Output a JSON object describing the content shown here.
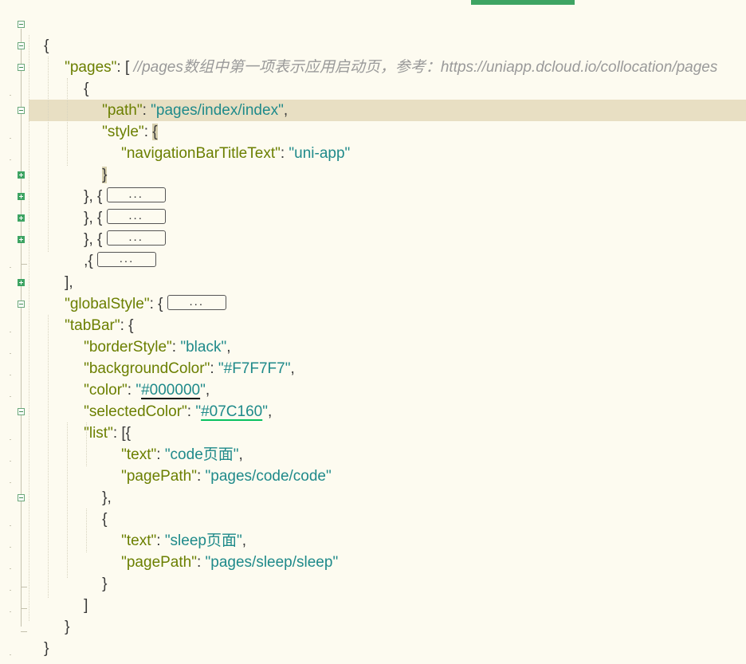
{
  "editor": {
    "colors": {
      "background": "#FDFBF0",
      "current_line": "#E8DFC3",
      "key": "#6B7F00",
      "string": "#1F8A8A",
      "comment": "#9A9A9A",
      "fold_collapsed": "#3EA463",
      "active_tab": "#3EA463"
    },
    "icons": {
      "fold_expanded": "minus-box-icon",
      "fold_collapsed": "plus-box-icon"
    },
    "placeholder": "...",
    "lines": {
      "l1": {
        "p1": "{"
      },
      "l2": {
        "k1": "\"pages\"",
        "p1": ": [ ",
        "comment": "//pages数组中第一项表示应用启动页，参考：https://uniapp.dcloud.io/collocation/pages"
      },
      "l3": {
        "p1": "{"
      },
      "l4": {
        "k1": "\"path\"",
        "p1": ": ",
        "s1": "\"pages/index/index\"",
        "p2": ","
      },
      "l5": {
        "k1": "\"style\"",
        "p1": ": ",
        "p2": "{"
      },
      "l6": {
        "k1": "\"navigationBarTitleText\"",
        "p1": ": ",
        "s1": "\"uni-app\""
      },
      "l7": {
        "p1": "}"
      },
      "l8": {
        "p1": "}, { "
      },
      "l9": {
        "p1": "}, { "
      },
      "l10": {
        "p1": "}, { "
      },
      "l11": {
        "p1": ",{ "
      },
      "l12": {
        "p1": "],"
      },
      "l13": {
        "k1": "\"globalStyle\"",
        "p1": ": { "
      },
      "l14": {
        "k1": "\"tabBar\"",
        "p1": ": {"
      },
      "l15": {
        "k1": "\"borderStyle\"",
        "p1": ": ",
        "s1": "\"black\"",
        "p2": ","
      },
      "l16": {
        "k1": "\"backgroundColor\"",
        "p1": ": ",
        "s1": "\"#F7F7F7\"",
        "p2": ","
      },
      "l17": {
        "k1": "\"color\"",
        "p1": ": ",
        "q1": "\"",
        "s1": "#000000",
        "q2": "\"",
        "p2": ",",
        "swatch": "#000000"
      },
      "l18": {
        "k1": "\"selectedColor\"",
        "p1": ": ",
        "q1": "\"",
        "s1": "#07C160",
        "q2": "\"",
        "p2": ",",
        "swatch": "#07C160"
      },
      "l19": {
        "k1": "\"list\"",
        "p1": ": [{"
      },
      "l20": {
        "k1": "\"text\"",
        "p1": ": ",
        "s1": "\"code页面\"",
        "p2": ","
      },
      "l21": {
        "k1": "\"pagePath\"",
        "p1": ": ",
        "s1": "\"pages/code/code\""
      },
      "l22": {
        "p1": "},"
      },
      "l23": {
        "p1": "{"
      },
      "l24": {
        "k1": "\"text\"",
        "p1": ": ",
        "s1": "\"sleep页面\"",
        "p2": ","
      },
      "l25": {
        "k1": "\"pagePath\"",
        "p1": ": ",
        "s1": "\"pages/sleep/sleep\""
      },
      "l26": {
        "p1": "}"
      },
      "l27": {
        "p1": "]"
      },
      "l28": {
        "p1": "}"
      },
      "l29": {
        "p1": "}"
      }
    }
  }
}
